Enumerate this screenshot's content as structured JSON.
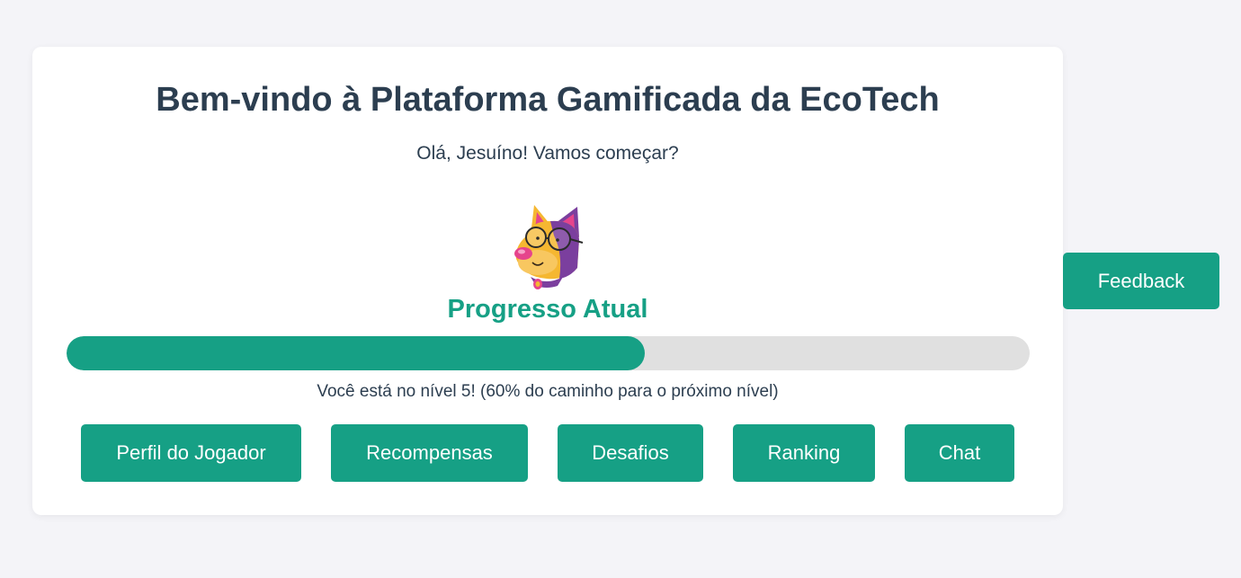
{
  "header": {
    "title": "Bem-vindo à Plataforma Gamificada da EcoTech",
    "greeting": "Olá, Jesuíno! Vamos começar?"
  },
  "progress": {
    "heading": "Progresso Atual",
    "percent": 60,
    "level": 5,
    "text": "Você está no nível 5! (60% do caminho para o próximo nível)"
  },
  "nav": {
    "profile_label": "Perfil do Jogador",
    "rewards_label": "Recompensas",
    "challenges_label": "Desafios",
    "ranking_label": "Ranking",
    "chat_label": "Chat"
  },
  "feedback": {
    "label": "Feedback"
  },
  "mascot": {
    "icon": "dog-mascot-with-glasses-icon"
  },
  "colors": {
    "accent": "#16a085",
    "title": "#2c3e50",
    "track": "#e0e0e0",
    "background": "#f4f4f8"
  }
}
